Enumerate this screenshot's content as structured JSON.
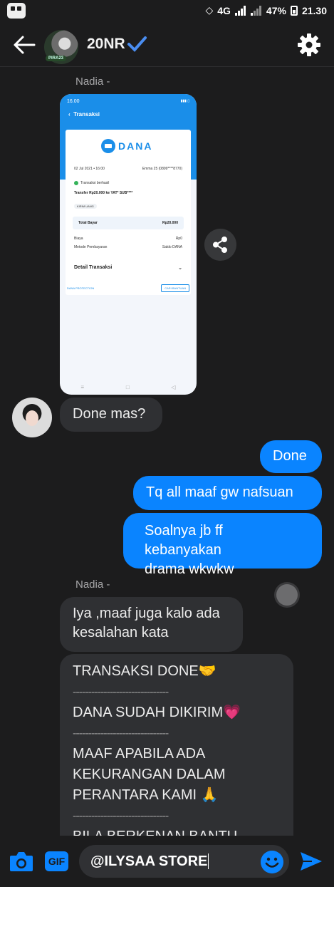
{
  "status": {
    "network": "4G",
    "sim1": "1",
    "sim2": "2",
    "battery": "47%",
    "time": "21.30"
  },
  "header": {
    "title": "20NR",
    "avatar_tag": "PIRA23"
  },
  "sender_name": "Nadia -",
  "screenshot": {
    "time": "16.00",
    "title": "Transaksi",
    "logo": "DANA",
    "date": "02 Jul 2021 • 16:00",
    "ref": "Emma 25 (0899****8770)",
    "status_text": "Transaksi berhasil",
    "transfer": "Transfer Rp20.000 ke YAT* SUB****",
    "pill": "KIRIM UANG",
    "total_label": "Total Bayar",
    "total_value": "Rp20.000",
    "fee_label": "Biaya",
    "fee_value": "Rp0",
    "method_label": "Metode Pembayaran",
    "method_value": "Saldo DANA",
    "detail": "Detail Transaksi",
    "protection": "DANA PROTECTION",
    "help": "CARI BANTUAN"
  },
  "messages": {
    "m1": "Done mas?",
    "m2": "Done",
    "m3": "Tq all maaf gw nafsuan",
    "m4_l1": "Soalnya jb ff kebanyakan",
    "m4_l2": "drama wkwkw",
    "m5_l1": "Iya ,maaf juga kalo ada",
    "m5_l2": "kesalahan kata",
    "m6_l1": "TRANSAKSI DONE🤝",
    "m6_sep": "-------------------------------",
    "m6_l2": "DANA SUDAH DIKIRIM💗",
    "m6_l3": "MAAF APABILA ADA",
    "m6_l4": "KEKURANGAN DALAM",
    "m6_l5": "PERANTARA KAMI 🙏",
    "m6_l6": "BILA BERKENAN BANTU"
  },
  "composer": {
    "gif_label": "GIF",
    "text": "@ILYSAA STORE"
  },
  "colors": {
    "accent": "#0a84ff",
    "background": "#1c1c1d",
    "incoming": "#2f3033"
  }
}
